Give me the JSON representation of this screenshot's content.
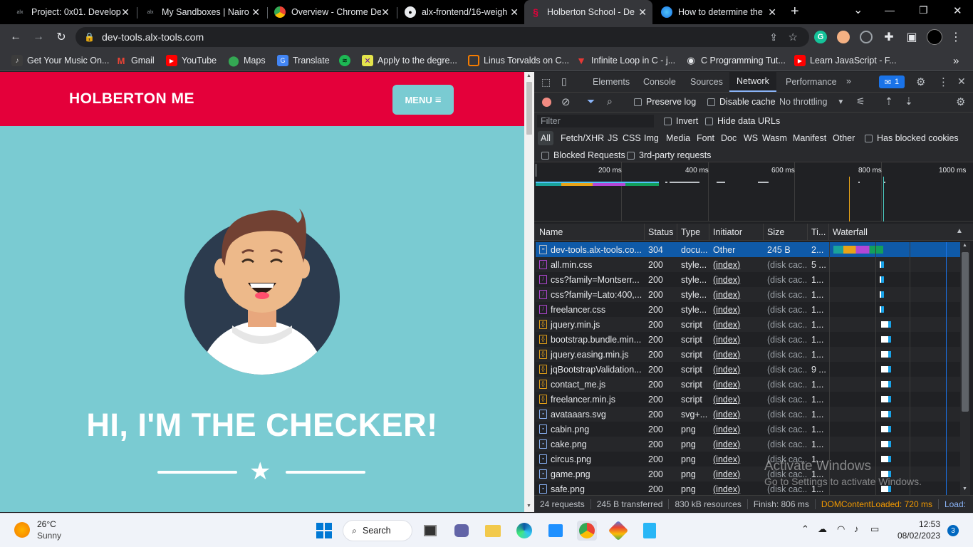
{
  "tabs": [
    {
      "title": "Project: 0x01. Develop",
      "favicon": "alx-icon"
    },
    {
      "title": "My Sandboxes | Nairo",
      "favicon": "alx-icon"
    },
    {
      "title": "Overview - Chrome De",
      "favicon": "chrome-icon"
    },
    {
      "title": "alx-frontend/16-weigh",
      "favicon": "github-icon"
    },
    {
      "title": "Holberton School - De",
      "favicon": "holberton-icon"
    },
    {
      "title": "How to determine the",
      "favicon": "globe-icon"
    }
  ],
  "window_controls": {
    "minimize": "—",
    "maximize": "❐",
    "close": "✕",
    "new_tab": "+",
    "tab_search": "⌄"
  },
  "address": {
    "url": "dev-tools.alx-tools.com"
  },
  "bookmarks": [
    {
      "label": "Get Your Music On...",
      "icon": "music-icon"
    },
    {
      "label": "Gmail",
      "icon": "gmail-icon"
    },
    {
      "label": "YouTube",
      "icon": "youtube-icon"
    },
    {
      "label": "Maps",
      "icon": "maps-icon"
    },
    {
      "label": "Translate",
      "icon": "translate-icon"
    },
    {
      "label": "",
      "icon": "spotify-icon"
    },
    {
      "label": "Apply to the degre...",
      "icon": "apply-icon"
    },
    {
      "label": "Linus Torvalds on C...",
      "icon": "linus-icon"
    },
    {
      "label": "Infinite Loop in C - j...",
      "icon": "loop-icon"
    },
    {
      "label": "C Programming Tut...",
      "icon": "cprog-icon"
    },
    {
      "label": "Learn JavaScript - F...",
      "icon": "youtube-icon"
    }
  ],
  "page": {
    "brand": "HOLBERTON ME",
    "menu_label": "MENU",
    "hero_title": "HI, I'M THE CHECKER!"
  },
  "devtools": {
    "tabs": [
      "Elements",
      "Console",
      "Sources",
      "Network",
      "Performance"
    ],
    "active_tab": "Network",
    "issues_count": "1",
    "toolbar": {
      "preserve_log": "Preserve log",
      "disable_cache": "Disable cache",
      "throttling": "No throttling"
    },
    "filter": {
      "placeholder": "Filter",
      "invert": "Invert",
      "hide_data_urls": "Hide data URLs"
    },
    "type_filters": [
      "All",
      "Fetch/XHR",
      "JS",
      "CSS",
      "Img",
      "Media",
      "Font",
      "Doc",
      "WS",
      "Wasm",
      "Manifest",
      "Other"
    ],
    "has_blocked_cookies": "Has blocked cookies",
    "blocked_requests": "Blocked Requests",
    "third_party": "3rd-party requests",
    "timeline_ticks": [
      "200 ms",
      "400 ms",
      "600 ms",
      "800 ms",
      "1000 ms"
    ],
    "columns": [
      "Name",
      "Status",
      "Type",
      "Initiator",
      "Size",
      "Ti...",
      "Waterfall"
    ],
    "rows": [
      {
        "name": "dev-tools.alx-tools.co...",
        "status": "304",
        "type": "docu...",
        "initiator": "Other",
        "size": "245 B",
        "time": "2...",
        "kind": "doc"
      },
      {
        "name": "all.min.css",
        "status": "200",
        "type": "style...",
        "initiator": "(index)",
        "size": "(disk cac...",
        "time": "5 ...",
        "kind": "css"
      },
      {
        "name": "css?family=Montserr...",
        "status": "200",
        "type": "style...",
        "initiator": "(index)",
        "size": "(disk cac...",
        "time": "1...",
        "kind": "css"
      },
      {
        "name": "css?family=Lato:400,...",
        "status": "200",
        "type": "style...",
        "initiator": "(index)",
        "size": "(disk cac...",
        "time": "1...",
        "kind": "css"
      },
      {
        "name": "freelancer.css",
        "status": "200",
        "type": "style...",
        "initiator": "(index)",
        "size": "(disk cac...",
        "time": "1...",
        "kind": "css"
      },
      {
        "name": "jquery.min.js",
        "status": "200",
        "type": "script",
        "initiator": "(index)",
        "size": "(disk cac...",
        "time": "1...",
        "kind": "js"
      },
      {
        "name": "bootstrap.bundle.min...",
        "status": "200",
        "type": "script",
        "initiator": "(index)",
        "size": "(disk cac...",
        "time": "1...",
        "kind": "js"
      },
      {
        "name": "jquery.easing.min.js",
        "status": "200",
        "type": "script",
        "initiator": "(index)",
        "size": "(disk cac...",
        "time": "1...",
        "kind": "js"
      },
      {
        "name": "jqBootstrapValidation...",
        "status": "200",
        "type": "script",
        "initiator": "(index)",
        "size": "(disk cac...",
        "time": "9 ...",
        "kind": "js"
      },
      {
        "name": "contact_me.js",
        "status": "200",
        "type": "script",
        "initiator": "(index)",
        "size": "(disk cac...",
        "time": "1...",
        "kind": "js"
      },
      {
        "name": "freelancer.min.js",
        "status": "200",
        "type": "script",
        "initiator": "(index)",
        "size": "(disk cac...",
        "time": "1...",
        "kind": "js"
      },
      {
        "name": "avataaars.svg",
        "status": "200",
        "type": "svg+...",
        "initiator": "(index)",
        "size": "(disk cac...",
        "time": "1...",
        "kind": "img"
      },
      {
        "name": "cabin.png",
        "status": "200",
        "type": "png",
        "initiator": "(index)",
        "size": "(disk cac...",
        "time": "1...",
        "kind": "img"
      },
      {
        "name": "cake.png",
        "status": "200",
        "type": "png",
        "initiator": "(index)",
        "size": "(disk cac...",
        "time": "1...",
        "kind": "img"
      },
      {
        "name": "circus.png",
        "status": "200",
        "type": "png",
        "initiator": "(index)",
        "size": "(disk cac...",
        "time": "1...",
        "kind": "img"
      },
      {
        "name": "game.png",
        "status": "200",
        "type": "png",
        "initiator": "(index)",
        "size": "(disk cac...",
        "time": "1...",
        "kind": "img"
      },
      {
        "name": "safe.png",
        "status": "200",
        "type": "png",
        "initiator": "(index)",
        "size": "(disk cac...",
        "time": "1...",
        "kind": "img"
      }
    ],
    "status_bar": {
      "requests": "24 requests",
      "transferred": "245 B transferred",
      "resources": "830 kB resources",
      "finish": "Finish: 806 ms",
      "dcl": "DOMContentLoaded: 720 ms",
      "load": "Load:"
    }
  },
  "watermark": {
    "line1": "Activate Windows",
    "line2": "Go to Settings to activate Windows."
  },
  "taskbar": {
    "weather_temp": "26°C",
    "weather_desc": "Sunny",
    "search_label": "Search",
    "time": "12:53",
    "date": "08/02/2023",
    "notification_count": "3"
  },
  "colors": {
    "brand_red": "#e4003a",
    "teal": "#7acbd2",
    "devtools_bg": "#202124",
    "selected_row": "#0f5aa8"
  }
}
